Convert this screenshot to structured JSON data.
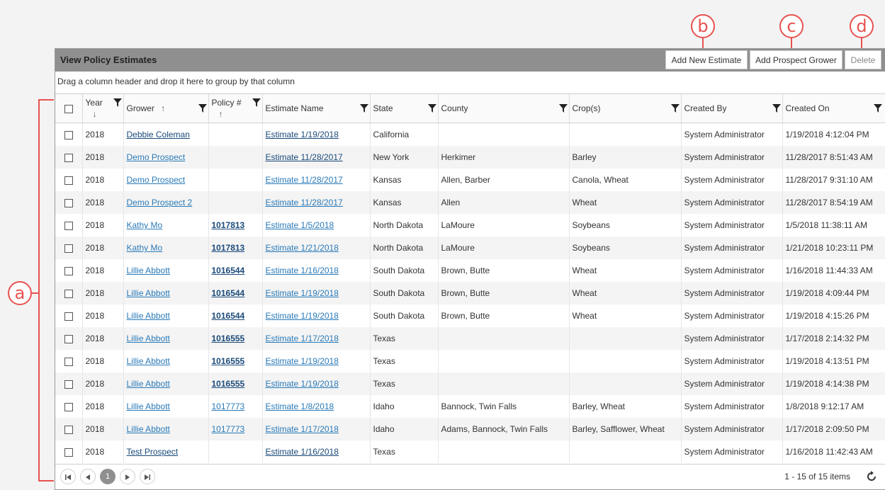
{
  "callouts": {
    "a": "a",
    "b": "b",
    "c": "c",
    "d": "d"
  },
  "panel": {
    "title": "View Policy Estimates",
    "buttons": {
      "add_estimate": "Add New Estimate",
      "add_prospect": "Add Prospect Grower",
      "delete": "Delete"
    },
    "group_hint": "Drag a column header and drop it here to group by that column"
  },
  "columns": {
    "year": "Year",
    "grower": "Grower",
    "policy": "Policy #",
    "estimate": "Estimate Name",
    "state": "State",
    "county": "County",
    "crops": "Crop(s)",
    "created_by": "Created By",
    "created_on": "Created On"
  },
  "rows": [
    {
      "year": "2018",
      "grower": "Debbie Coleman",
      "policy": "",
      "estimate": "Estimate 1/19/2018",
      "state": "California",
      "county": "",
      "crops": "",
      "created_by": "System Administrator",
      "created_on": "1/19/2018 4:12:04 PM"
    },
    {
      "year": "2018",
      "grower": "Demo Prospect",
      "policy": "",
      "estimate": "Estimate 11/28/2017",
      "state": "New York",
      "county": "Herkimer",
      "crops": "Barley",
      "created_by": "System Administrator",
      "created_on": "11/28/2017 8:51:43 AM"
    },
    {
      "year": "2018",
      "grower": "Demo Prospect",
      "policy": "",
      "estimate": "Estimate 11/28/2017",
      "state": "Kansas",
      "county": "Allen, Barber",
      "crops": "Canola, Wheat",
      "created_by": "System Administrator",
      "created_on": "11/28/2017 9:31:10 AM"
    },
    {
      "year": "2018",
      "grower": "Demo Prospect 2",
      "policy": "",
      "estimate": "Estimate 11/28/2017",
      "state": "Kansas",
      "county": "Allen",
      "crops": "Wheat",
      "created_by": "System Administrator",
      "created_on": "11/28/2017 8:54:19 AM"
    },
    {
      "year": "2018",
      "grower": "Kathy Mo",
      "policy": "1017813",
      "estimate": "Estimate 1/5/2018",
      "state": "North Dakota",
      "county": "LaMoure",
      "crops": "Soybeans",
      "created_by": "System Administrator",
      "created_on": "1/5/2018 11:38:11 AM"
    },
    {
      "year": "2018",
      "grower": "Kathy Mo",
      "policy": "1017813",
      "estimate": "Estimate 1/21/2018",
      "state": "North Dakota",
      "county": "LaMoure",
      "crops": "Soybeans",
      "created_by": "System Administrator",
      "created_on": "1/21/2018 10:23:11 PM"
    },
    {
      "year": "2018",
      "grower": "Lillie Abbott",
      "policy": "1016544",
      "estimate": "Estimate 1/16/2018",
      "state": "South Dakota",
      "county": "Brown, Butte",
      "crops": "Wheat",
      "created_by": "System Administrator",
      "created_on": "1/16/2018 11:44:33 AM"
    },
    {
      "year": "2018",
      "grower": "Lillie Abbott",
      "policy": "1016544",
      "estimate": "Estimate 1/19/2018",
      "state": "South Dakota",
      "county": "Brown, Butte",
      "crops": "Wheat",
      "created_by": "System Administrator",
      "created_on": "1/19/2018 4:09:44 PM"
    },
    {
      "year": "2018",
      "grower": "Lillie Abbott",
      "policy": "1016544",
      "estimate": "Estimate 1/19/2018",
      "state": "South Dakota",
      "county": "Brown, Butte",
      "crops": "Wheat",
      "created_by": "System Administrator",
      "created_on": "1/19/2018 4:15:26 PM"
    },
    {
      "year": "2018",
      "grower": "Lillie Abbott",
      "policy": "1016555",
      "estimate": "Estimate 1/17/2018",
      "state": "Texas",
      "county": "",
      "crops": "",
      "created_by": "System Administrator",
      "created_on": "1/17/2018 2:14:32 PM"
    },
    {
      "year": "2018",
      "grower": "Lillie Abbott",
      "policy": "1016555",
      "estimate": "Estimate 1/19/2018",
      "state": "Texas",
      "county": "",
      "crops": "",
      "created_by": "System Administrator",
      "created_on": "1/19/2018 4:13:51 PM"
    },
    {
      "year": "2018",
      "grower": "Lillie Abbott",
      "policy": "1016555",
      "estimate": "Estimate 1/19/2018",
      "state": "Texas",
      "county": "",
      "crops": "",
      "created_by": "System Administrator",
      "created_on": "1/19/2018 4:14:38 PM"
    },
    {
      "year": "2018",
      "grower": "Lillie Abbott",
      "policy": "1017773",
      "estimate": "Estimate 1/8/2018",
      "state": "Idaho",
      "county": "Bannock, Twin Falls",
      "crops": "Barley, Wheat",
      "created_by": "System Administrator",
      "created_on": "1/8/2018 9:12:17 AM"
    },
    {
      "year": "2018",
      "grower": "Lillie Abbott",
      "policy": "1017773",
      "estimate": "Estimate 1/17/2018",
      "state": "Idaho",
      "county": "Adams, Bannock, Twin Falls",
      "crops": "Barley, Safflower, Wheat",
      "created_by": "System Administrator",
      "created_on": "1/17/2018 2:09:50 PM"
    },
    {
      "year": "2018",
      "grower": "Test Prospect",
      "policy": "",
      "estimate": "Estimate 1/16/2018",
      "state": "Texas",
      "county": "",
      "crops": "",
      "created_by": "System Administrator",
      "created_on": "1/16/2018 11:42:43 AM"
    }
  ],
  "pager": {
    "current_page": "1",
    "info": "1 - 15 of 15 items"
  },
  "colors": {
    "accent": "#e8524f",
    "title_bar": "#8f8f8f",
    "link": "#2a7ab8",
    "link_visited": "#1a4a7a"
  }
}
